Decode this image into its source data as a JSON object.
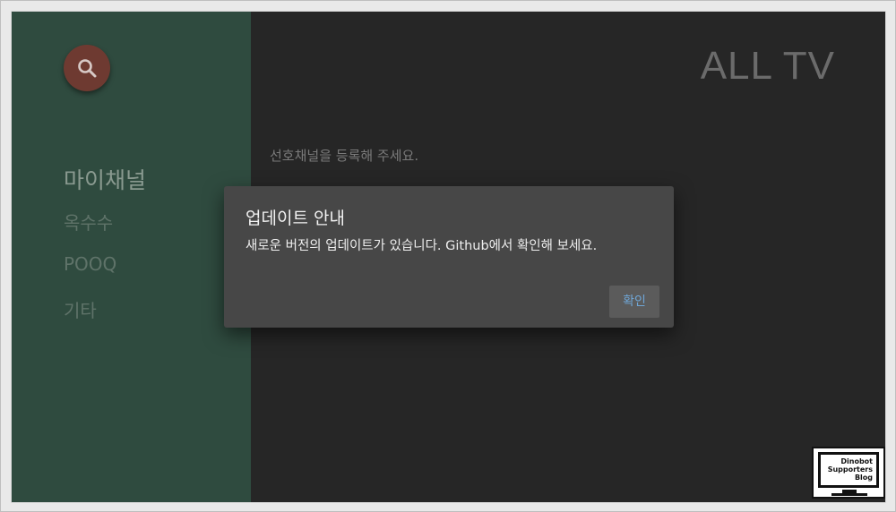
{
  "sidebar": {
    "search_icon": "search-icon",
    "items": [
      {
        "label": "마이채널",
        "active": true
      },
      {
        "label": "옥수수",
        "active": false
      },
      {
        "label": "POOQ",
        "active": false
      },
      {
        "label": "기타",
        "active": false
      }
    ]
  },
  "header": {
    "title": "ALL TV"
  },
  "main": {
    "empty_message": "선호채널을 등록해 주세요."
  },
  "dialog": {
    "title": "업데이트 안내",
    "message": "새로운 버전의 업데이트가 있습니다. Github에서 확인해 보세요.",
    "confirm_label": "확인"
  },
  "watermark": {
    "lines": [
      "Dinobot",
      "Supporters",
      "Blog"
    ]
  },
  "colors": {
    "sidebar_bg": "#2f4b3f",
    "content_bg": "#262626",
    "search_button": "#6e3a31",
    "dialog_bg": "#474747",
    "button_text": "#6fa6d6"
  }
}
